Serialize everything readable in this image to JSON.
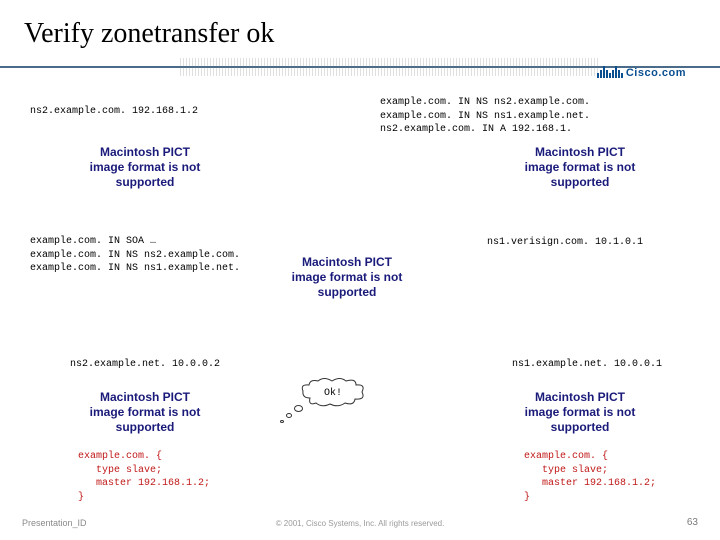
{
  "title": "Verify zonetransfer ok",
  "logo_text": "Cisco.com",
  "labels": {
    "top_left": "ns2.example.com. 192.168.1.2",
    "top_right": "example.com. IN NS ns2.example.com.\nexample.com. IN NS ns1.example.net.\nns2.example.com. IN A 192.168.1.",
    "mid_left": "example.com. IN SOA …\nexample.com. IN NS ns2.example.com.\nexample.com. IN NS ns1.example.net.",
    "mid_right": "ns1.verisign.com. 10.1.0.1",
    "lower_left_net": "ns2.example.net. 10.0.0.2",
    "lower_right_net": "ns1.example.net. 10.0.0.1",
    "bubble": "Ok!",
    "config_left": "example.com. {\n   type slave;\n   master 192.168.1.2;\n}",
    "config_right": "example.com. {\n   type slave;\n   master 192.168.1.2;\n}"
  },
  "error_text": "Macintosh PICT image format is not supported",
  "footer": {
    "left": "Presentation_ID",
    "center": "© 2001, Cisco Systems, Inc. All rights reserved.",
    "right": "63"
  }
}
